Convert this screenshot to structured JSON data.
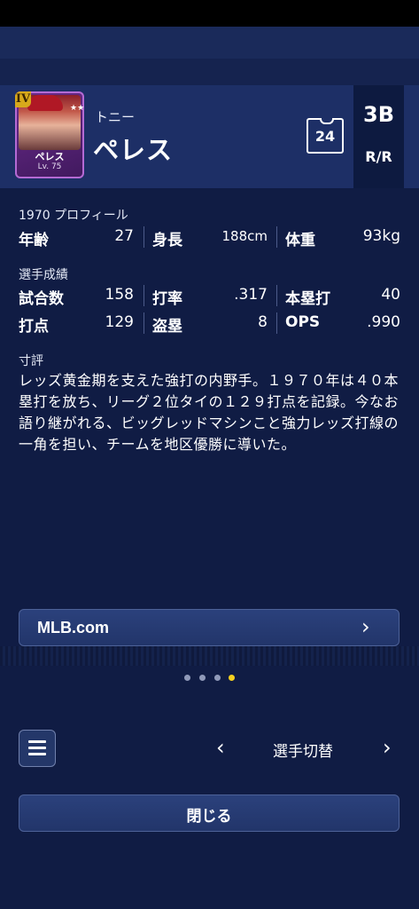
{
  "player": {
    "first_name": "トニー",
    "last_name": "ペレス",
    "card_tier": "IV",
    "card_name": "ペレス",
    "card_level": "Lv. 75",
    "card_stars": "★★★★★",
    "number": "24",
    "position": "3B",
    "handedness": "R/R"
  },
  "profile": {
    "label": "1970 プロフィール",
    "stats": [
      {
        "label": "年齢",
        "value": "27"
      },
      {
        "label": "身長",
        "value": "188cm"
      },
      {
        "label": "体重",
        "value": "93kg"
      }
    ]
  },
  "record": {
    "label": "選手成績",
    "rows": [
      [
        {
          "label": "試合数",
          "value": "158"
        },
        {
          "label": "打率",
          "value": ".317"
        },
        {
          "label": "本塁打",
          "value": "40"
        }
      ],
      [
        {
          "label": "打点",
          "value": "129"
        },
        {
          "label": "盗塁",
          "value": "8"
        },
        {
          "label": "OPS",
          "value": ".990"
        }
      ]
    ]
  },
  "review": {
    "label": "寸評",
    "text": "レッズ黄金期を支えた強打の内野手。１９７０年は４０本塁打を放ち、リーグ２位タイの１２９打点を記録。今なお語り継がれる、ビッグレッドマシンこと強力レッズ打線の一角を担い、チームを地区優勝に導いた。"
  },
  "links": {
    "mlb_label": "MLB.com",
    "chevron": "›"
  },
  "pager": {
    "total": 4,
    "active_index": 3,
    "active_color": "#f5d020"
  },
  "footer": {
    "switch_label": "選手切替",
    "prev": "‹",
    "next": "›",
    "close_label": "閉じる"
  },
  "icons": {
    "menu": "menu-icon",
    "jersey": "jersey-icon"
  }
}
